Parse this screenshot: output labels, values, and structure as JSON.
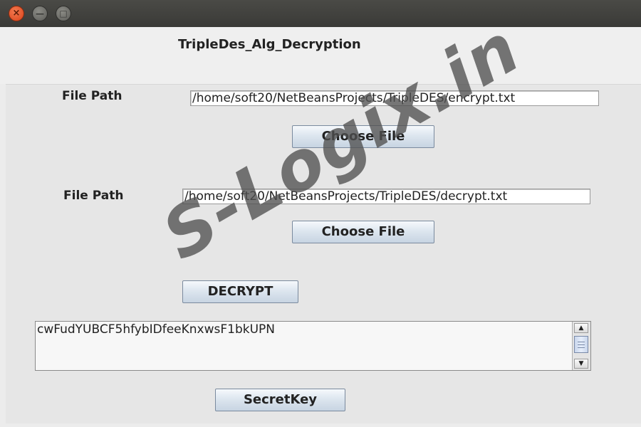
{
  "window": {
    "controls": {
      "close": "×",
      "minimize": "—",
      "maximize": "□"
    }
  },
  "app_title": "TripleDes_Alg_Decryption",
  "encrypt_section": {
    "label": "File Path",
    "path_value": "/home/soft20/NetBeansProjects/TripleDES/encrypt.txt",
    "button_label": "Choose File"
  },
  "decrypt_section": {
    "label": "File Path",
    "path_value": "/home/soft20/NetBeansProjects/TripleDES/decrypt.txt",
    "button_label": "Choose File"
  },
  "decrypt_button_label": "DECRYPT",
  "output_text": "cwFudYUBCF5hfybIDfeeKnxwsF1bkUPN",
  "secret_key_button_label": "SecretKey",
  "watermark_text": "S-Logix.in",
  "colors": {
    "titlebar": "#3f3f3c",
    "close_button": "#e4562a",
    "window_bg": "#ececec",
    "button_gradient_top": "#f6f9fc",
    "button_gradient_bottom": "#c7d4e2"
  }
}
